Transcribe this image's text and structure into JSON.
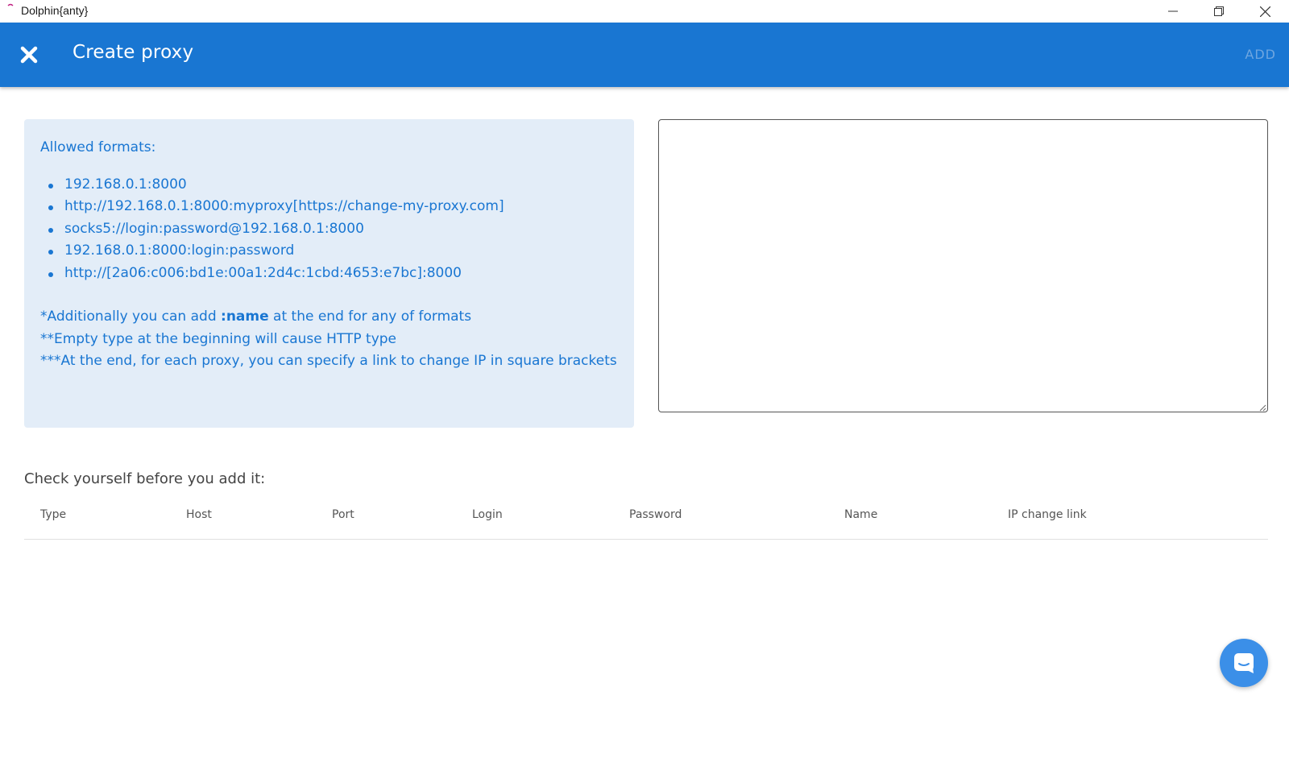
{
  "window": {
    "title": "Dolphin{anty}",
    "controls": [
      "minimize",
      "restore",
      "close"
    ]
  },
  "header": {
    "title": "Create proxy",
    "add_label": "ADD",
    "close_icon": "close-icon",
    "background": "#1976d2"
  },
  "info": {
    "title": "Allowed formats:",
    "formats": [
      "192.168.0.1:8000",
      "http://192.168.0.1:8000:myproxy[https://change-my-proxy.com]",
      "socks5://login:password@192.168.0.1:8000",
      "192.168.0.1:8000:login:password",
      "http://[2a06:c006:bd1e:00a1:2d4c:1cbd:4653:e7bc]:8000"
    ],
    "note1_pre": "*Additionally you can add ",
    "note1_bold": ":name",
    "note1_post": " at the end for any of formats",
    "note2": "**Empty type at the beginning will cause HTTP type",
    "note3": "***At the end, for each proxy, you can specify a link to change IP in square brackets"
  },
  "input": {
    "value": "",
    "placeholder": ""
  },
  "check": {
    "title": "Check yourself before you add it:",
    "columns": [
      "Type",
      "Host",
      "Port",
      "Login",
      "Password",
      "Name",
      "IP change link"
    ],
    "rows": []
  },
  "chat": {
    "icon": "chat-icon",
    "color": "#3b8fe8"
  }
}
